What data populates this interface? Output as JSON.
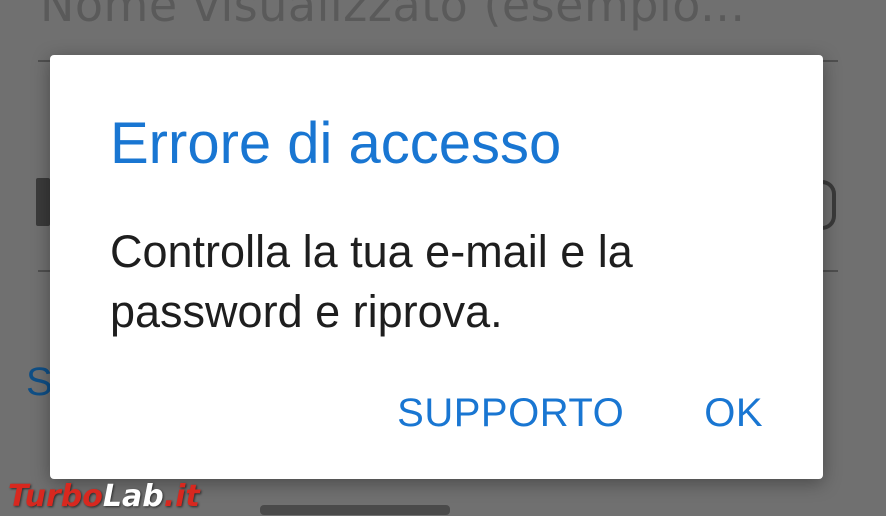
{
  "background": {
    "field_hint_text": "Nome visualizzato (esempio...",
    "left_link_fragment": "S"
  },
  "dialog": {
    "title": "Errore di accesso",
    "message": "Controlla la tua e-mail e la password e riprova.",
    "buttons": {
      "support_label": "SUPPORTO",
      "ok_label": "OK"
    }
  },
  "watermark": {
    "part1": "Turbo",
    "part2": "Lab",
    "part3": ".it"
  },
  "colors": {
    "accent": "#1976d2",
    "text": "#1e1e1e",
    "scrim": "#707070",
    "dialog_bg": "#ffffff",
    "watermark_red": "#d8281f"
  }
}
